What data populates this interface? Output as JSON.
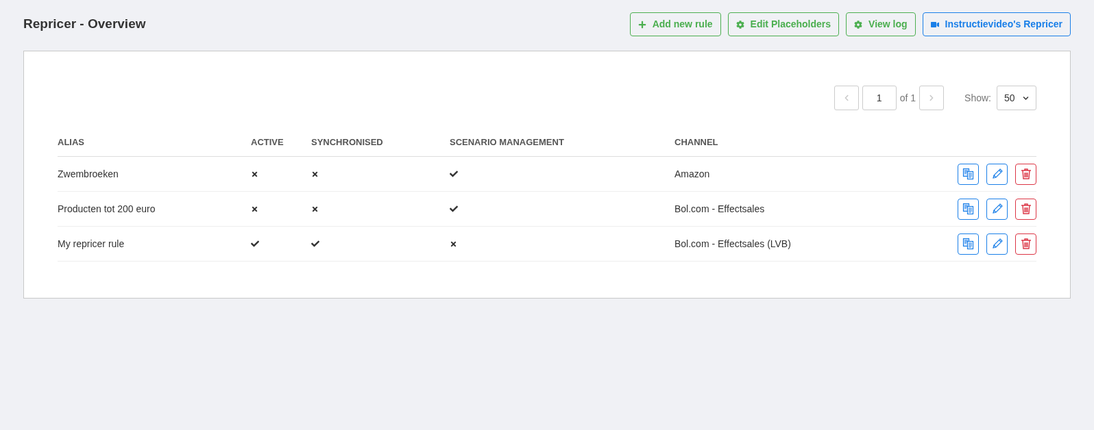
{
  "title": "Repricer - Overview",
  "header_buttons": [
    {
      "label": "Add new rule",
      "kind": "add",
      "color": "#4caf50"
    },
    {
      "label": "Edit Placeholders",
      "kind": "settings",
      "color": "#4caf50"
    },
    {
      "label": "View log",
      "kind": "settings",
      "color": "#4caf50"
    },
    {
      "label": "Instructievideo's Repricer",
      "kind": "video",
      "color": "#1a7fe8"
    }
  ],
  "pagination": {
    "page": "1",
    "of_label": "of 1",
    "show_label": "Show:",
    "page_size": "50"
  },
  "table": {
    "columns": [
      "ALIAS",
      "ACTIVE",
      "SYNCHRONISED",
      "SCENARIO MANAGEMENT",
      "CHANNEL"
    ],
    "rows": [
      {
        "alias": "Zwembroeken",
        "active": false,
        "synchronised": false,
        "scenario_management": true,
        "channel": "Amazon"
      },
      {
        "alias": "Producten tot 200 euro",
        "active": false,
        "synchronised": false,
        "scenario_management": true,
        "channel": "Bol.com - Effectsales"
      },
      {
        "alias": "My repricer rule",
        "active": true,
        "synchronised": true,
        "scenario_management": false,
        "channel": "Bol.com - Effectsales (LVB)"
      }
    ]
  }
}
